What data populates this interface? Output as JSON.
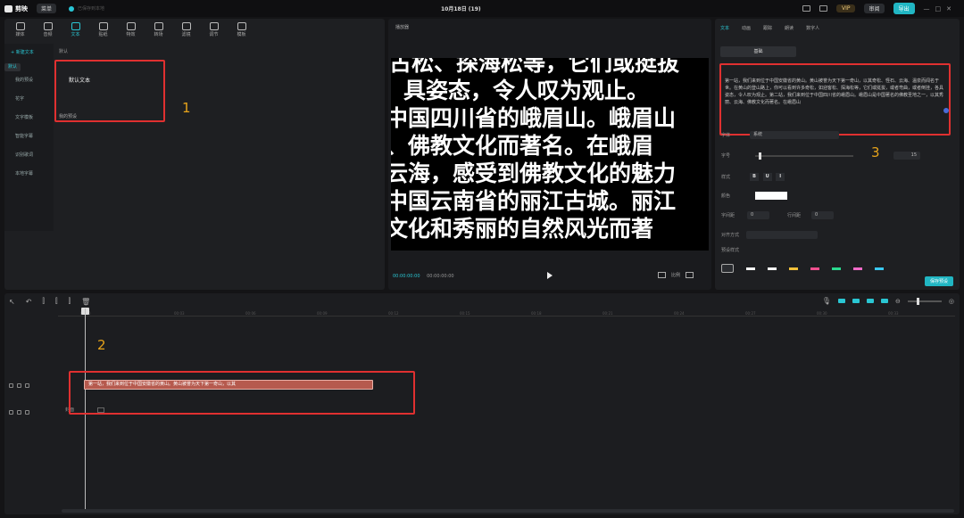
{
  "app": {
    "name": "剪映",
    "menu": "菜单",
    "date": "10月18日 (19)",
    "status": "已保存到本地"
  },
  "topright": {
    "vip": "VIP",
    "share": "审阅",
    "export": "导出"
  },
  "tabs": [
    {
      "label": "媒体",
      "icon": "media-icon"
    },
    {
      "label": "音频",
      "icon": "audio-icon"
    },
    {
      "label": "文本",
      "icon": "text-icon",
      "active": true
    },
    {
      "label": "贴纸",
      "icon": "sticker-icon"
    },
    {
      "label": "特效",
      "icon": "effects-icon"
    },
    {
      "label": "转场",
      "icon": "transition-icon"
    },
    {
      "label": "滤镜",
      "icon": "filter-icon"
    },
    {
      "label": "调节",
      "icon": "adjust-icon"
    },
    {
      "label": "模板",
      "icon": "template-icon"
    }
  ],
  "sidebar": [
    "+ 新建文本",
    "默认",
    "我的预设",
    "花字",
    "文字模板",
    "智能字幕",
    "识别歌词",
    "本地字幕"
  ],
  "content": {
    "title": "默认",
    "card_label": "默认文本",
    "card_sub": "我的预设"
  },
  "player": {
    "title": "播放器",
    "lines": [
      "古松、探海松等，它们或挺拔",
      "具姿态，令人叹为观止。",
      "中国四川省的峨眉山。峨眉山",
      "、佛教文化而著名。在峨眉",
      "云海，感受到佛教文化的魅力",
      "中国云南省的丽江古城。丽江",
      "文化和秀丽的自然风光而著"
    ],
    "time_current": "00:00:00:00",
    "time_total": "00:00:00:00",
    "ratio": "比例"
  },
  "right": {
    "tabs": [
      "文本",
      "动画",
      "跟踪",
      "朗读",
      "数字人"
    ],
    "subtab": "基础",
    "text": "第一站，我们来到位于中国安徽省的黄山。黄山被誉为天下第一奇山，以其奇松、怪石、云海、温泉而闻名于世。在黄山的登山路上，你可以看到许多奇松，如迎客松、探海松等，它们或挺拔，或者弯曲，或者倒挂，各具姿态，令人叹为观止。第二站，我们来到位于中国四川省的峨眉山。峨眉山是中国著名的佛教圣地之一，以其秀丽、云海、佛教文化而著名。在峨眉山",
    "font_label": "字体",
    "font_value": "系统",
    "size_label": "字号",
    "size_value": "15",
    "style_label": "样式",
    "style_btns": [
      "B",
      "U",
      "I"
    ],
    "color_label": "颜色",
    "spacing_label": "字间距",
    "spacing_value": "0",
    "line_label": "行间距",
    "line_value": "0",
    "align_label": "对齐方式",
    "preset_label": "预设样式",
    "preset_colors": [
      "#ffffff",
      "#ffffff",
      "#f2c13a",
      "#f24f8f",
      "#2ad98f",
      "#f26ac8",
      "#3ac9f2"
    ],
    "save_btn": "保存预设"
  },
  "timeline": {
    "ticks": [
      "00:00",
      "00:03",
      "00:06",
      "00:09",
      "00:12",
      "00:15",
      "00:18",
      "00:21",
      "00:24",
      "00:27",
      "00:30",
      "00:33",
      "00:36"
    ],
    "text_clip": "第一站，我们来到位于中国安徽省的黄山。黄山被誉为天下第一奇山，以其",
    "cover": "封面"
  },
  "annotations": [
    "1",
    "2",
    "3"
  ]
}
